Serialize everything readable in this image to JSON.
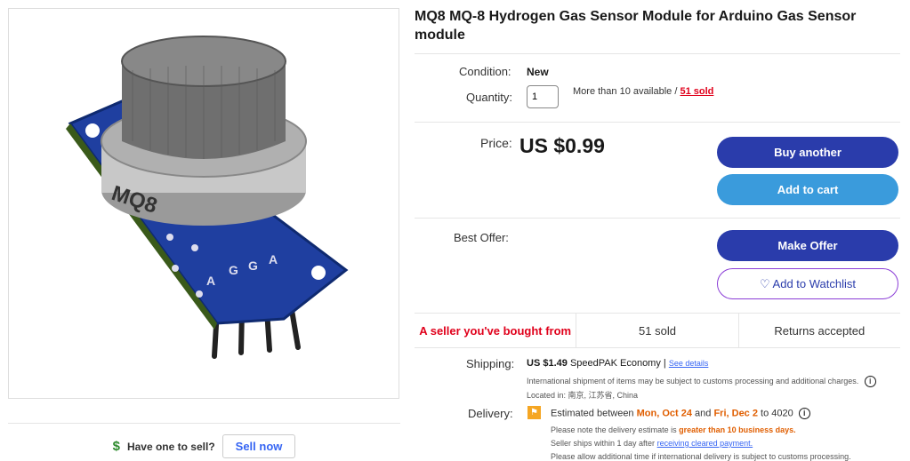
{
  "product": {
    "title": "MQ8 MQ-8 Hydrogen Gas Sensor Module for Arduino Gas Sensor module",
    "image_alt": "MQ-8 gas sensor module with mesh cap on blue PCB",
    "board_labels": [
      "A",
      "G",
      "G",
      "A"
    ],
    "image_brand_text": "MQ8"
  },
  "sell": {
    "icon": "$",
    "prompt": "Have one to sell?",
    "button": "Sell now"
  },
  "condition": {
    "label": "Condition:",
    "value": "New"
  },
  "quantity": {
    "label": "Quantity:",
    "value": "1",
    "available": "More than 10 available /",
    "sold": "51 sold"
  },
  "price": {
    "label": "Price:",
    "value": "US $0.99"
  },
  "buttons": {
    "buy": "Buy another",
    "cart": "Add to cart",
    "offer": "Make Offer",
    "watch": "♡ Add to Watchlist"
  },
  "best_offer": {
    "label": "Best Offer:"
  },
  "stats": {
    "seller": "A seller you've bought from",
    "sold": "51 sold",
    "returns": "Returns accepted"
  },
  "shipping": {
    "label": "Shipping:",
    "price": "US $1.49",
    "method": "SpeedPAK Economy |",
    "details": "See details",
    "note": "International shipment of items may be subject to customs processing and additional charges.",
    "location": "Located in: 南京, 江苏省, China"
  },
  "delivery": {
    "label": "Delivery:",
    "prefix": "Estimated between",
    "start": "Mon, Oct 24",
    "and": "and",
    "end": "Fri, Dec 2",
    "to": "to 4020",
    "note_prefix": "Please note the delivery estimate is",
    "note_highlight": "greater than 10 business days.",
    "ships_prefix": "Seller ships within 1 day after",
    "ships_link": "receiving cleared payment.",
    "extra": "Please allow additional time if international delivery is subject to customs processing."
  },
  "colors": {
    "primary_button": "#2a3cab",
    "cart_button": "#3a9bdc",
    "link": "#3665f3",
    "alert_red": "#e0001b",
    "delivery_orange": "#e05e00"
  }
}
